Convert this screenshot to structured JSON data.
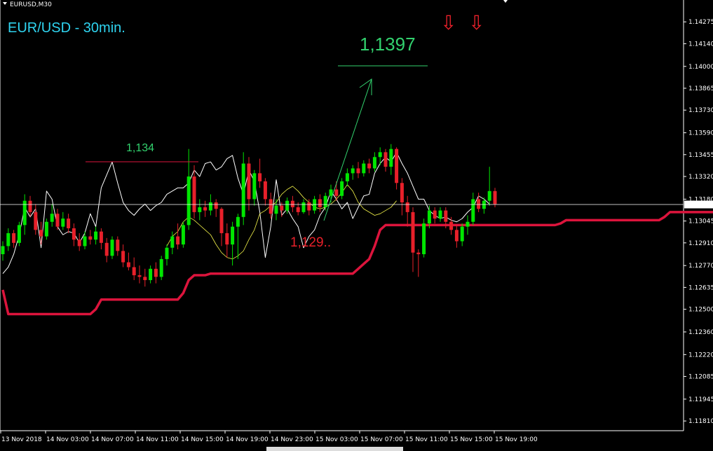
{
  "window": {
    "symbol_tab": "EURUSD,M30",
    "title": "EUR/USD - 30min."
  },
  "colors": {
    "background": "#000000",
    "bull": "#00e600",
    "bear": "#e8202a",
    "thick_line": "#dc143c",
    "white_line": "#ffffff",
    "signal_line": "#f4f44a",
    "annotation_green": "#32d26e",
    "title_cyan": "#2fd4f0",
    "axis": "#ffffff"
  },
  "annotations": {
    "target": "1,1397",
    "resistance": "1,134",
    "support": "1,129..",
    "down_arrow_icon": "⇩"
  },
  "chart_data": {
    "type": "candlestick",
    "title": "EUR/USD - 30min.",
    "current_price": 1.13147,
    "current_price_label": "1.13147",
    "y_ticks": [
      "1.14275",
      "1.14140",
      "1.14000",
      "1.13865",
      "1.13730",
      "1.13590",
      "1.13455",
      "1.13320",
      "1.13180",
      "1.13045",
      "1.12910",
      "1.12770",
      "1.12635",
      "1.12500",
      "1.12360",
      "1.12220",
      "1.12085",
      "1.11945",
      "1.11810"
    ],
    "y_tick_values": [
      1.14275,
      1.1414,
      1.14,
      1.13865,
      1.1373,
      1.1359,
      1.13455,
      1.1332,
      1.1318,
      1.13045,
      1.1291,
      1.1277,
      1.12635,
      1.125,
      1.1236,
      1.1222,
      1.12085,
      1.11945,
      1.1181
    ],
    "ylim": [
      1.1175,
      1.1441
    ],
    "x_labels": [
      "13 Nov 2018",
      "14 Nov 03:00",
      "14 Nov 07:00",
      "14 Nov 11:00",
      "14 Nov 15:00",
      "14 Nov 19:00",
      "14 Nov 23:00",
      "15 Nov 03:00",
      "15 Nov 07:00",
      "15 Nov 11:00",
      "15 Nov 15:00",
      "15 Nov 19:00"
    ],
    "candles": [
      {
        "o": 1.1284,
        "h": 1.1292,
        "l": 1.128,
        "c": 1.1289
      },
      {
        "o": 1.1289,
        "h": 1.13,
        "l": 1.1286,
        "c": 1.1297
      },
      {
        "o": 1.1297,
        "h": 1.1299,
        "l": 1.1288,
        "c": 1.1291
      },
      {
        "o": 1.1291,
        "h": 1.1304,
        "l": 1.1289,
        "c": 1.1302
      },
      {
        "o": 1.1302,
        "h": 1.1321,
        "l": 1.1296,
        "c": 1.1317
      },
      {
        "o": 1.1317,
        "h": 1.132,
        "l": 1.1307,
        "c": 1.131
      },
      {
        "o": 1.131,
        "h": 1.1315,
        "l": 1.1296,
        "c": 1.1299
      },
      {
        "o": 1.1299,
        "h": 1.1304,
        "l": 1.129,
        "c": 1.1295
      },
      {
        "o": 1.1295,
        "h": 1.1306,
        "l": 1.1293,
        "c": 1.1304
      },
      {
        "o": 1.1304,
        "h": 1.1315,
        "l": 1.1301,
        "c": 1.1309
      },
      {
        "o": 1.1309,
        "h": 1.1312,
        "l": 1.1299,
        "c": 1.1301
      },
      {
        "o": 1.1301,
        "h": 1.131,
        "l": 1.1299,
        "c": 1.1306
      },
      {
        "o": 1.1306,
        "h": 1.1309,
        "l": 1.1297,
        "c": 1.13
      },
      {
        "o": 1.13,
        "h": 1.1303,
        "l": 1.1289,
        "c": 1.1293
      },
      {
        "o": 1.1293,
        "h": 1.1297,
        "l": 1.1286,
        "c": 1.1289
      },
      {
        "o": 1.1289,
        "h": 1.1298,
        "l": 1.1287,
        "c": 1.1295
      },
      {
        "o": 1.1295,
        "h": 1.1299,
        "l": 1.129,
        "c": 1.1293
      },
      {
        "o": 1.1293,
        "h": 1.1301,
        "l": 1.129,
        "c": 1.1298
      },
      {
        "o": 1.1298,
        "h": 1.13,
        "l": 1.1287,
        "c": 1.1291
      },
      {
        "o": 1.1291,
        "h": 1.1294,
        "l": 1.1279,
        "c": 1.1283
      },
      {
        "o": 1.1283,
        "h": 1.1295,
        "l": 1.1281,
        "c": 1.1293
      },
      {
        "o": 1.1293,
        "h": 1.1295,
        "l": 1.1283,
        "c": 1.1286
      },
      {
        "o": 1.1286,
        "h": 1.129,
        "l": 1.1276,
        "c": 1.1279
      },
      {
        "o": 1.1279,
        "h": 1.1285,
        "l": 1.1274,
        "c": 1.1276
      },
      {
        "o": 1.1276,
        "h": 1.1282,
        "l": 1.1268,
        "c": 1.1271
      },
      {
        "o": 1.1271,
        "h": 1.1277,
        "l": 1.1266,
        "c": 1.127
      },
      {
        "o": 1.127,
        "h": 1.1275,
        "l": 1.1264,
        "c": 1.1268
      },
      {
        "o": 1.1268,
        "h": 1.1277,
        "l": 1.1266,
        "c": 1.1275
      },
      {
        "o": 1.1275,
        "h": 1.1279,
        "l": 1.1266,
        "c": 1.127
      },
      {
        "o": 1.127,
        "h": 1.1283,
        "l": 1.1268,
        "c": 1.1281
      },
      {
        "o": 1.1281,
        "h": 1.129,
        "l": 1.1277,
        "c": 1.1288
      },
      {
        "o": 1.1288,
        "h": 1.1298,
        "l": 1.1284,
        "c": 1.1295
      },
      {
        "o": 1.1295,
        "h": 1.1303,
        "l": 1.1287,
        "c": 1.129
      },
      {
        "o": 1.129,
        "h": 1.1304,
        "l": 1.1288,
        "c": 1.1302
      },
      {
        "o": 1.1302,
        "h": 1.1349,
        "l": 1.1299,
        "c": 1.1332
      },
      {
        "o": 1.1332,
        "h": 1.1339,
        "l": 1.1306,
        "c": 1.131
      },
      {
        "o": 1.131,
        "h": 1.1318,
        "l": 1.1305,
        "c": 1.1313
      },
      {
        "o": 1.1313,
        "h": 1.1317,
        "l": 1.1307,
        "c": 1.1311
      },
      {
        "o": 1.1311,
        "h": 1.1321,
        "l": 1.1308,
        "c": 1.1316
      },
      {
        "o": 1.1316,
        "h": 1.1318,
        "l": 1.1307,
        "c": 1.1312
      },
      {
        "o": 1.1312,
        "h": 1.1313,
        "l": 1.1289,
        "c": 1.1297
      },
      {
        "o": 1.1297,
        "h": 1.1303,
        "l": 1.1282,
        "c": 1.129
      },
      {
        "o": 1.129,
        "h": 1.1304,
        "l": 1.1277,
        "c": 1.1301
      },
      {
        "o": 1.1301,
        "h": 1.1309,
        "l": 1.1281,
        "c": 1.1307
      },
      {
        "o": 1.1307,
        "h": 1.1347,
        "l": 1.1302,
        "c": 1.134
      },
      {
        "o": 1.134,
        "h": 1.1344,
        "l": 1.1311,
        "c": 1.1318
      },
      {
        "o": 1.1318,
        "h": 1.1336,
        "l": 1.1314,
        "c": 1.1334
      },
      {
        "o": 1.1334,
        "h": 1.1343,
        "l": 1.1325,
        "c": 1.1329
      },
      {
        "o": 1.1329,
        "h": 1.1331,
        "l": 1.1314,
        "c": 1.1318
      },
      {
        "o": 1.1318,
        "h": 1.1322,
        "l": 1.1306,
        "c": 1.1309
      },
      {
        "o": 1.1309,
        "h": 1.1318,
        "l": 1.1305,
        "c": 1.1314
      },
      {
        "o": 1.1314,
        "h": 1.1316,
        "l": 1.1307,
        "c": 1.1311
      },
      {
        "o": 1.1311,
        "h": 1.1319,
        "l": 1.1309,
        "c": 1.1317
      },
      {
        "o": 1.1317,
        "h": 1.132,
        "l": 1.131,
        "c": 1.1313
      },
      {
        "o": 1.1313,
        "h": 1.1316,
        "l": 1.1308,
        "c": 1.131
      },
      {
        "o": 1.131,
        "h": 1.1318,
        "l": 1.1309,
        "c": 1.1316
      },
      {
        "o": 1.1316,
        "h": 1.1318,
        "l": 1.1308,
        "c": 1.1311
      },
      {
        "o": 1.1311,
        "h": 1.132,
        "l": 1.1309,
        "c": 1.1318
      },
      {
        "o": 1.1318,
        "h": 1.1321,
        "l": 1.131,
        "c": 1.1313
      },
      {
        "o": 1.1313,
        "h": 1.1322,
        "l": 1.1311,
        "c": 1.132
      },
      {
        "o": 1.132,
        "h": 1.1327,
        "l": 1.1316,
        "c": 1.1324
      },
      {
        "o": 1.1324,
        "h": 1.1329,
        "l": 1.1317,
        "c": 1.132
      },
      {
        "o": 1.132,
        "h": 1.1331,
        "l": 1.1318,
        "c": 1.1329
      },
      {
        "o": 1.1329,
        "h": 1.1337,
        "l": 1.1326,
        "c": 1.1334
      },
      {
        "o": 1.1334,
        "h": 1.1339,
        "l": 1.133,
        "c": 1.1337
      },
      {
        "o": 1.1337,
        "h": 1.1341,
        "l": 1.1331,
        "c": 1.1334
      },
      {
        "o": 1.1334,
        "h": 1.1342,
        "l": 1.1332,
        "c": 1.134
      },
      {
        "o": 1.134,
        "h": 1.1343,
        "l": 1.1334,
        "c": 1.1337
      },
      {
        "o": 1.1337,
        "h": 1.1347,
        "l": 1.1335,
        "c": 1.1344
      },
      {
        "o": 1.1344,
        "h": 1.135,
        "l": 1.1339,
        "c": 1.1347
      },
      {
        "o": 1.1347,
        "h": 1.1349,
        "l": 1.1335,
        "c": 1.1338
      },
      {
        "o": 1.1338,
        "h": 1.1352,
        "l": 1.1333,
        "c": 1.1349
      },
      {
        "o": 1.1349,
        "h": 1.135,
        "l": 1.1324,
        "c": 1.1328
      },
      {
        "o": 1.1328,
        "h": 1.1331,
        "l": 1.1308,
        "c": 1.1316
      },
      {
        "o": 1.1316,
        "h": 1.132,
        "l": 1.1301,
        "c": 1.131
      },
      {
        "o": 1.131,
        "h": 1.1313,
        "l": 1.1273,
        "c": 1.1285
      },
      {
        "o": 1.1285,
        "h": 1.1287,
        "l": 1.127,
        "c": 1.1284
      },
      {
        "o": 1.1284,
        "h": 1.1306,
        "l": 1.1282,
        "c": 1.1303
      },
      {
        "o": 1.1303,
        "h": 1.1314,
        "l": 1.13,
        "c": 1.1311
      },
      {
        "o": 1.1311,
        "h": 1.1313,
        "l": 1.1303,
        "c": 1.1306
      },
      {
        "o": 1.1306,
        "h": 1.1313,
        "l": 1.1304,
        "c": 1.1311
      },
      {
        "o": 1.1311,
        "h": 1.1313,
        "l": 1.13,
        "c": 1.1304
      },
      {
        "o": 1.1304,
        "h": 1.1307,
        "l": 1.1296,
        "c": 1.1299
      },
      {
        "o": 1.1299,
        "h": 1.1302,
        "l": 1.1288,
        "c": 1.1292
      },
      {
        "o": 1.1292,
        "h": 1.1303,
        "l": 1.1289,
        "c": 1.1301
      },
      {
        "o": 1.1301,
        "h": 1.1308,
        "l": 1.1296,
        "c": 1.1304
      },
      {
        "o": 1.1304,
        "h": 1.1322,
        "l": 1.1302,
        "c": 1.1318
      },
      {
        "o": 1.1318,
        "h": 1.1322,
        "l": 1.131,
        "c": 1.1312
      },
      {
        "o": 1.1312,
        "h": 1.1319,
        "l": 1.1309,
        "c": 1.1317
      },
      {
        "o": 1.1317,
        "h": 1.1338,
        "l": 1.1314,
        "c": 1.1323
      },
      {
        "o": 1.1323,
        "h": 1.1325,
        "l": 1.1313,
        "c": 1.1315
      }
    ],
    "thick_line": [
      1.1262,
      1.1247,
      1.1247,
      1.1247,
      1.1247,
      1.1247,
      1.1247,
      1.1247,
      1.1247,
      1.1247,
      1.1247,
      1.1247,
      1.1247,
      1.1247,
      1.1247,
      1.1247,
      1.1247,
      1.125,
      1.1256,
      1.1256,
      1.1256,
      1.1256,
      1.1256,
      1.1256,
      1.1256,
      1.1256,
      1.1256,
      1.1256,
      1.1256,
      1.1256,
      1.1256,
      1.1256,
      1.1256,
      1.126,
      1.1268,
      1.1271,
      1.1271,
      1.1271,
      1.1272,
      1.1272,
      1.1272,
      1.1272,
      1.1272,
      1.1272,
      1.1272,
      1.1272,
      1.1272,
      1.1272,
      1.1272,
      1.1272,
      1.1272,
      1.1272,
      1.1272,
      1.1272,
      1.1272,
      1.1272,
      1.1272,
      1.1272,
      1.1272,
      1.1272,
      1.1272,
      1.1272,
      1.1272,
      1.1272,
      1.1272,
      1.1275,
      1.1278,
      1.1281,
      1.1289,
      1.1299,
      1.1302,
      1.1302,
      1.1302,
      1.1302,
      1.1302,
      1.1302,
      1.1302,
      1.1302,
      1.1302,
      1.1302,
      1.1302,
      1.1302,
      1.1302,
      1.1302,
      1.1302,
      1.1302,
      1.1302,
      1.1302,
      1.1302,
      1.1302,
      1.1302,
      1.1302,
      1.1302,
      1.1302,
      1.1302,
      1.1302,
      1.1302,
      1.1302,
      1.1302,
      1.1302,
      1.1302,
      1.1302,
      1.1303,
      1.1305,
      1.1305,
      1.1305,
      1.1305,
      1.1305,
      1.1305,
      1.1305,
      1.1305,
      1.1305,
      1.1305,
      1.1305,
      1.1305,
      1.1305,
      1.1305,
      1.1305,
      1.1305,
      1.1305,
      1.1305,
      1.1307,
      1.131,
      1.131,
      1.131,
      1.131,
      1.131,
      1.131,
      1.131,
      1.131,
      1.131
    ],
    "white_line": [
      1.1272,
      1.1276,
      1.1284,
      1.1296,
      1.1313,
      1.1307,
      1.1312,
      1.1288,
      1.1323,
      1.1318,
      1.1301,
      1.1296,
      1.1298,
      1.1297,
      1.1291,
      1.1297,
      1.1309,
      1.1301,
      1.1325,
      1.1333,
      1.1341,
      1.1328,
      1.1316,
      1.1311,
      1.1308,
      1.1312,
      1.1315,
      1.1311,
      1.1314,
      1.1316,
      1.1321,
      1.1323,
      1.1325,
      1.1325,
      1.1328,
      1.1336,
      1.1332,
      1.134,
      1.1341,
      1.1336,
      1.1338,
      1.1343,
      1.1345,
      1.1331,
      1.1321,
      1.1336,
      1.1329,
      1.131,
      1.1282,
      1.1301,
      1.133,
      1.1308,
      1.1312,
      1.1306,
      1.1301,
      1.1288,
      1.1295,
      1.1299,
      1.1308,
      1.1313,
      1.1323,
      1.1318,
      1.1312,
      1.1316,
      1.1306,
      1.1313,
      1.132,
      1.1321,
      1.1334,
      1.134,
      1.1344,
      1.1341,
      1.1347,
      1.134,
      1.1334,
      1.1326,
      1.1318,
      1.1318,
      1.1311,
      1.1308,
      1.1306,
      1.1307,
      1.1305,
      1.1304,
      1.1306,
      1.131,
      1.1313,
      1.132,
      1.1318,
      1.1315
    ],
    "signal_line": [
      1.1289,
      1.1295,
      1.1298,
      1.1304,
      1.1307,
      1.1305,
      1.1302,
      1.1299,
      1.1296,
      1.129,
      1.1285,
      1.1282,
      1.1281,
      1.1283,
      1.1286,
      1.1293,
      1.1299,
      1.1309,
      1.1311,
      1.1314,
      1.1316,
      1.1321,
      1.1324,
      1.1326,
      1.1323,
      1.1319,
      1.1316,
      1.1313,
      1.1312,
      1.1313,
      1.1315,
      1.1318,
      1.1322,
      1.1327,
      1.1323,
      1.1316,
      1.1312,
      1.131,
      1.1308,
      1.1309,
      1.1311,
      1.1313,
      1.1317
    ]
  }
}
